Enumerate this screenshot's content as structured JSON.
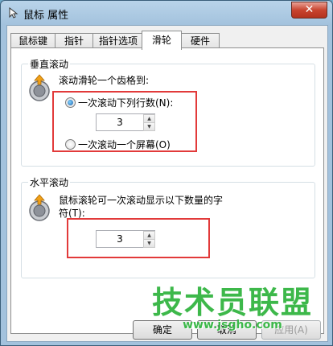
{
  "window": {
    "title": "鼠标 属性",
    "close_glyph": "✕"
  },
  "tabs": [
    {
      "label": "鼠标键"
    },
    {
      "label": "指针"
    },
    {
      "label": "指针选项"
    },
    {
      "label": "滑轮",
      "active": true
    },
    {
      "label": "硬件"
    }
  ],
  "vertical": {
    "title": "垂直滚动",
    "prompt": "滚动滑轮一个齿格到:",
    "option_lines": "一次滚动下列行数(N):",
    "lines_value": "3",
    "option_screen": "一次滚动一个屏幕(O)",
    "selected": "lines"
  },
  "horizontal": {
    "title": "水平滚动",
    "prompt_line1": "鼠标滚轮可一次滚动显示以下数量的字",
    "prompt_line2": "符(T):",
    "chars_value": "3"
  },
  "buttons": {
    "ok": "确定",
    "cancel": "取消",
    "apply": "应用(A)"
  },
  "watermark": {
    "title": "技术员联盟",
    "url": "www.jsgho.com"
  },
  "colors": {
    "highlight_box": "#e23a3a",
    "watermark": "#3db84a"
  }
}
